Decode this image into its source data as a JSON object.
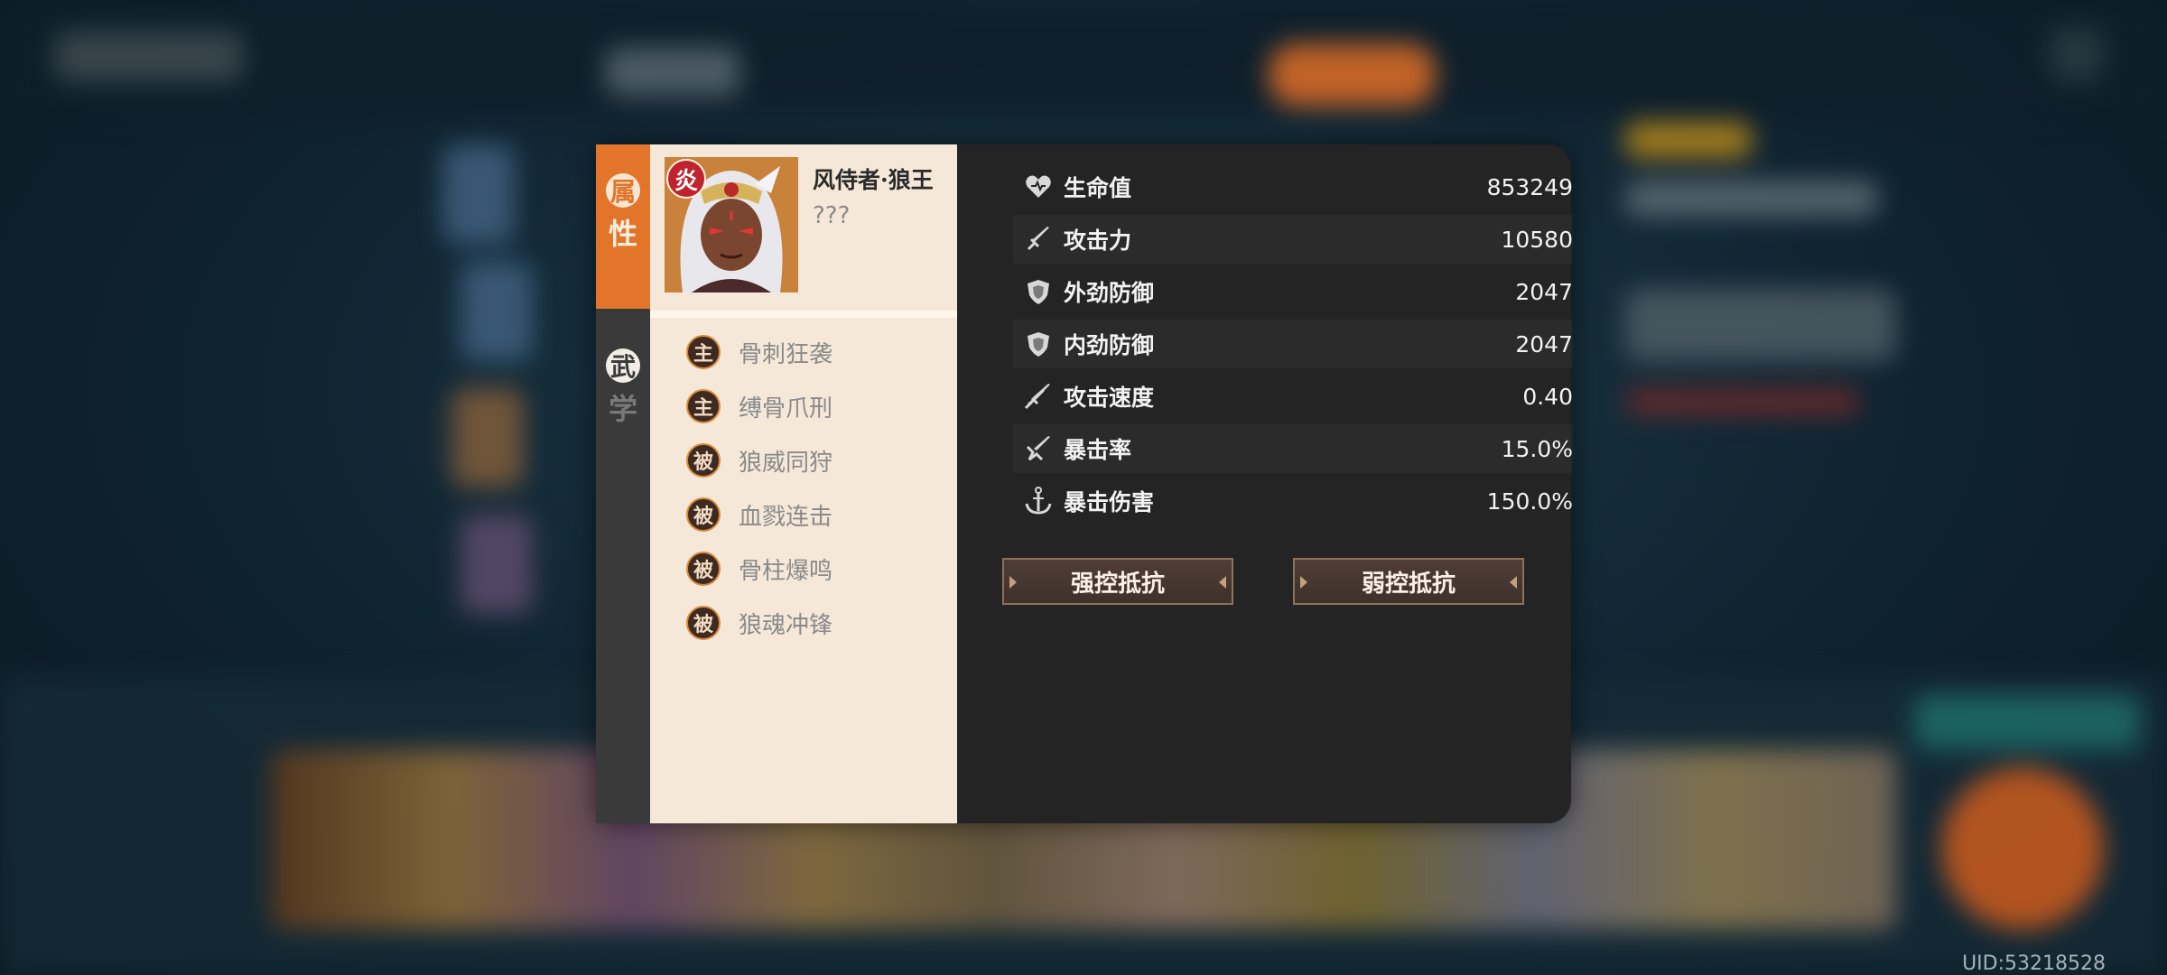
{
  "uid_text": "UID:53218528",
  "tabs": [
    {
      "char1": "属",
      "char2": "性",
      "active": true
    },
    {
      "char1": "武",
      "char2": "学",
      "active": false
    }
  ],
  "hero": {
    "element": "炎",
    "name": "风侍者·狼王",
    "subtitle": "???"
  },
  "skills": [
    {
      "type": "主",
      "name": "骨刺狂袭"
    },
    {
      "type": "主",
      "name": "缚骨爪刑"
    },
    {
      "type": "被",
      "name": "狼威同狩"
    },
    {
      "type": "被",
      "name": "血戮连击"
    },
    {
      "type": "被",
      "name": "骨柱爆鸣"
    },
    {
      "type": "被",
      "name": "狼魂冲锋"
    }
  ],
  "stats": [
    {
      "icon": "heart-icon",
      "label": "生命值",
      "value": "853249"
    },
    {
      "icon": "sword-icon",
      "label": "攻击力",
      "value": "10580"
    },
    {
      "icon": "shield-icon",
      "label": "外劲防御",
      "value": "2047"
    },
    {
      "icon": "shield-icon",
      "label": "内劲防御",
      "value": "2047"
    },
    {
      "icon": "double-sword-icon",
      "label": "攻击速度",
      "value": "0.40"
    },
    {
      "icon": "crit-icon",
      "label": "暴击率",
      "value": "15.0%"
    },
    {
      "icon": "anchor-icon",
      "label": "暴击伤害",
      "value": "150.0%"
    }
  ],
  "buttons": {
    "strong_control": "强控抵抗",
    "weak_control": "弱控抵抗"
  }
}
